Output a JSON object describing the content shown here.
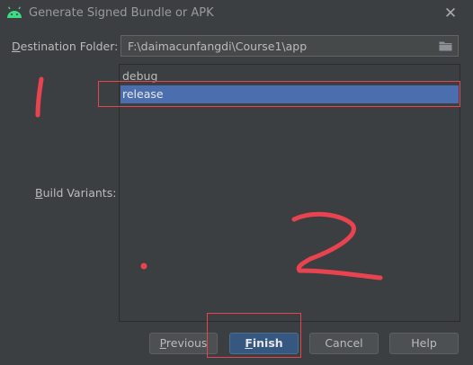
{
  "window": {
    "title": "Generate Signed Bundle or APK",
    "app_icon": "android-icon",
    "close_icon": "close-icon"
  },
  "destination": {
    "label_mnemonic": "D",
    "label_rest": "estination Folder:",
    "value": "F:\\daimacunfangdi\\Course1\\app",
    "browse_icon": "folder-icon"
  },
  "variants": {
    "label_mnemonic": "B",
    "label_rest": "uild Variants:",
    "items": [
      {
        "label": "debug",
        "selected": false
      },
      {
        "label": "release",
        "selected": true
      }
    ]
  },
  "buttons": {
    "previous": {
      "mnemonic": "P",
      "rest": "revious"
    },
    "finish": {
      "mnemonic": "F",
      "rest": "inish"
    },
    "cancel": {
      "label": "Cancel"
    },
    "help": {
      "label": "Help"
    }
  },
  "annotations": {
    "color": "#e8434f",
    "marks": [
      "1",
      "2"
    ]
  },
  "colors": {
    "background": "#3c3f41",
    "selection": "#4b6eaf",
    "primary_button": "#365880",
    "annotation": "#e8434f"
  }
}
